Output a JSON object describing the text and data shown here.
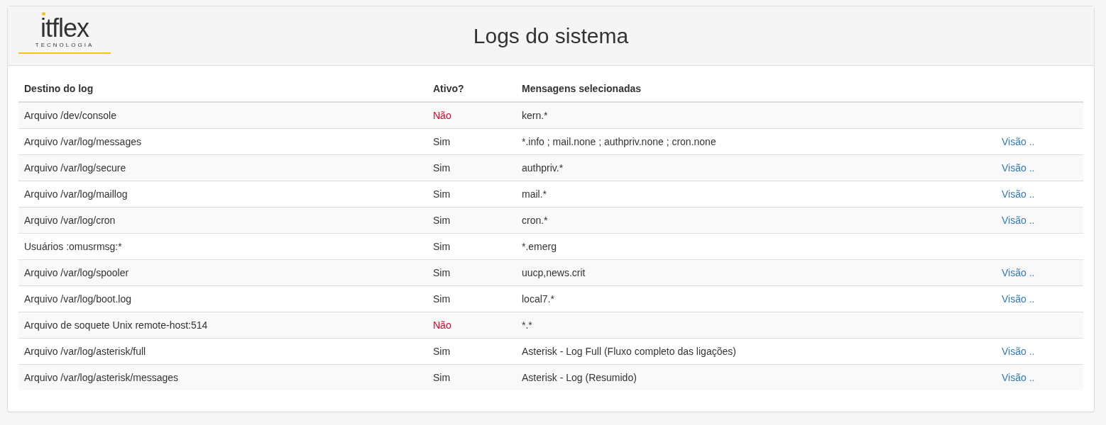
{
  "header": {
    "logo": {
      "name": "itflex",
      "tagline": "TECNOLOGIA"
    },
    "title": "Logs do sistema"
  },
  "table": {
    "columns": [
      "Destino do log",
      "Ativo?",
      "Mensagens selecionadas"
    ],
    "rows": [
      {
        "destination": "Arquivo /dev/console",
        "active": false,
        "active_text": "Não",
        "messages": "kern.*"
      },
      {
        "destination": "Arquivo /var/log/messages",
        "active": true,
        "active_text": "Sim",
        "messages": "*.info ; mail.none ; authpriv.none ; cron.none",
        "link": "Visão .."
      },
      {
        "destination": "Arquivo /var/log/secure",
        "active": true,
        "active_text": "Sim",
        "messages": "authpriv.*",
        "link": "Visão .."
      },
      {
        "destination": "Arquivo /var/log/maillog",
        "active": true,
        "active_text": "Sim",
        "messages": "mail.*",
        "link": "Visão .."
      },
      {
        "destination": "Arquivo /var/log/cron",
        "active": true,
        "active_text": "Sim",
        "messages": "cron.*",
        "link": "Visão .."
      },
      {
        "destination": "Usuários :omusrmsg:*",
        "active": true,
        "active_text": "Sim",
        "messages": "*.emerg"
      },
      {
        "destination": "Arquivo /var/log/spooler",
        "active": true,
        "active_text": "Sim",
        "messages": "uucp,news.crit",
        "link": "Visão .."
      },
      {
        "destination": "Arquivo /var/log/boot.log",
        "active": true,
        "active_text": "Sim",
        "messages": "local7.*",
        "link": "Visão .."
      },
      {
        "destination": "Arquivo de soquete Unix remote-host:514",
        "active": false,
        "active_text": "Não",
        "messages": "*.*"
      },
      {
        "destination": "Arquivo /var/log/asterisk/full",
        "active": true,
        "active_text": "Sim",
        "messages": "Asterisk - Log Full (Fluxo completo das ligações)",
        "link": "Visão .."
      },
      {
        "destination": "Arquivo /var/log/asterisk/messages",
        "active": true,
        "active_text": "Sim",
        "messages": "Asterisk - Log (Resumido)",
        "link": "Visão .."
      }
    ]
  }
}
